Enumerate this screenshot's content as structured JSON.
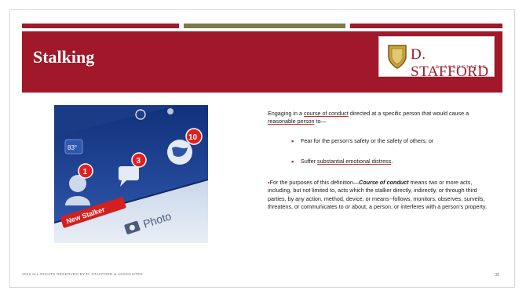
{
  "slide": {
    "title": "Stalking",
    "logo": {
      "name": "D. STAFFORD",
      "sub": "& ASSOCIATES"
    },
    "colors": {
      "header": "#a0182a",
      "bar_red": "#a0182a",
      "bar_olive": "#7d7a4a"
    },
    "photo": {
      "alert_new_stalker": "New Stalker",
      "badge_friends": "1",
      "badge_messages": "3",
      "badge_notifications": "10",
      "temp_label": "83°",
      "photo_button": "Photo"
    },
    "content": {
      "intro_part1": "Engaging in a ",
      "intro_link1": "course of conduct",
      "intro_part2": " directed at a specific person that would cause a ",
      "intro_link2": "reasonable person",
      "intro_part3": " to—",
      "bullet1": "Fear for the person’s safety or the safety of others; or",
      "bullet2_prefix": "Suffer ",
      "bullet2_link": "substantial emotional distress",
      "bullet2_suffix": ".",
      "def_prefix": "For the purposes of this definition—",
      "def_term": "Course of conduct",
      "def_body": " means two or more acts, including, but not limited to, acts which the stalker directly, indirectly, or through third parties, by any action, method, device, or means--follows, monitors, observes, surveils, threatens, or communicates to or about, a person, or interferes with a person’s property."
    },
    "footer": "2022 ALL RIGHTS RESERVED BY D. STAFFORD & ASSOCIATES",
    "page_number": "38"
  }
}
